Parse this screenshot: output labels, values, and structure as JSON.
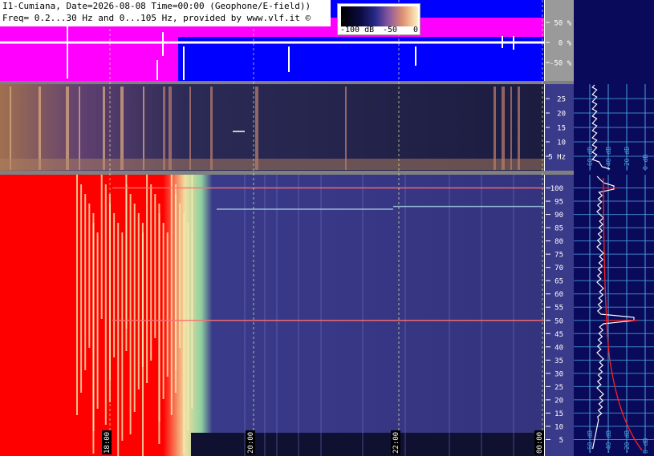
{
  "header": {
    "line1": "I1-Cumiana, Date=2026-08-08 Time=00:00 (Geophone/E-field))",
    "line2": "Freq= 0.2...30 Hz and 0...105 Hz, provided by www.vlf.it ©"
  },
  "colorbar": {
    "labels": [
      "-100 dB",
      "-50",
      "0"
    ],
    "colors": [
      "#000000",
      "#2a2a8a",
      "#e09070",
      "#fff2c0"
    ]
  },
  "colors": {
    "magenta": "#ff00ff",
    "blue": "#0000ff",
    "saturated_red": "#ff0000",
    "spectrogram_bg": "#3a3a8a",
    "side_panel": "#0a0a5a",
    "side_grid": "#4aa0e0",
    "spectrum_white": "#ffffff",
    "spectrum_red": "#ff2020"
  },
  "chart_data": [
    {
      "type": "line",
      "panel": "amplitude",
      "y_ticks": [
        "50 %",
        "0 %",
        "-50 %"
      ],
      "ylim": [
        -100,
        100
      ],
      "series": [
        {
          "values": [
            0,
            2,
            -1,
            3,
            0,
            -2,
            1,
            0
          ]
        }
      ]
    },
    {
      "type": "heatmap",
      "panel": "spectrogram-low",
      "y_ticks": [
        "25",
        "20",
        "15",
        "10",
        "5 Hz"
      ],
      "ylim": [
        0,
        30
      ]
    },
    {
      "type": "heatmap",
      "panel": "spectrogram-high",
      "y_ticks": [
        "100",
        "95",
        "90",
        "85",
        "80",
        "75",
        "70",
        "65",
        "60",
        "55",
        "50",
        "45",
        "40",
        "35",
        "30",
        "25",
        "20",
        "15",
        "10",
        "5"
      ],
      "x_ticks": [
        "18:00",
        "20:00",
        "22:00",
        "00:00"
      ],
      "ylim": [
        0,
        105
      ],
      "lines_hz": [
        100,
        93,
        92,
        50
      ]
    },
    {
      "type": "line",
      "panel": "spectrum-high",
      "x_ticks": [
        "-60 dB",
        "-40 dB",
        "-20 dB",
        "0 dB"
      ],
      "ylim": [
        0,
        105
      ]
    }
  ]
}
